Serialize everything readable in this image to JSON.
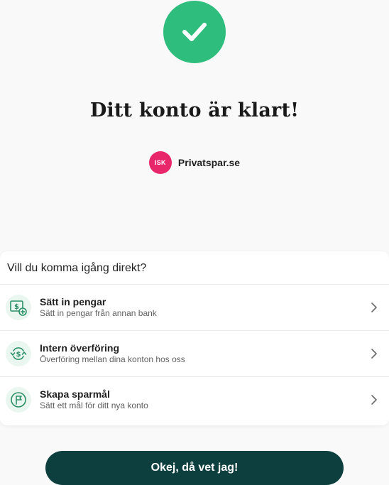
{
  "success": {
    "icon": "checkmark-icon",
    "title": "Ditt konto är klart!"
  },
  "account": {
    "badge": "ISK",
    "name": "Privatspar.se",
    "badge_color": "#e8276b"
  },
  "actions_card": {
    "heading": "Vill du komma igång direkt?",
    "items": [
      {
        "icon": "deposit-icon",
        "title": "Sätt in pengar",
        "subtitle": "Sätt in pengar från annan bank"
      },
      {
        "icon": "transfer-icon",
        "title": "Intern överföring",
        "subtitle": "Överföring mellan dina konton hos oss"
      },
      {
        "icon": "goal-flag-icon",
        "title": "Skapa sparmål",
        "subtitle": "Sätt ett mål för ditt nya konto"
      }
    ]
  },
  "footer": {
    "confirm_label": "Okej, då vet jag!"
  },
  "colors": {
    "accent_green": "#2fbd7e",
    "icon_green": "#2b8f66",
    "button_dark": "#0e3f3f"
  }
}
